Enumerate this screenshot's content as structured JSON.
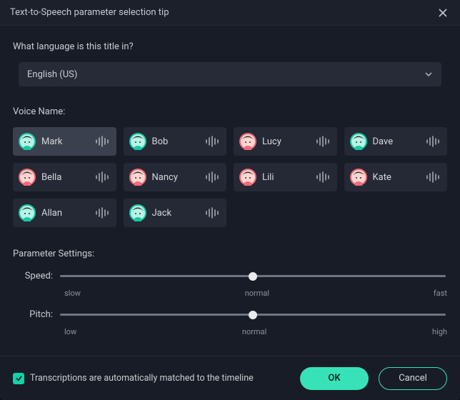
{
  "dialog": {
    "title": "Text-to-Speech parameter selection tip"
  },
  "language": {
    "label": "What language is this title in?",
    "selected": "English (US)"
  },
  "voice": {
    "label": "Voice Name:",
    "selected_index": 0,
    "items": [
      {
        "name": "Mark",
        "avatar_color": "teal"
      },
      {
        "name": "Bob",
        "avatar_color": "teal"
      },
      {
        "name": "Lucy",
        "avatar_color": "pink"
      },
      {
        "name": "Dave",
        "avatar_color": "teal"
      },
      {
        "name": "Bella",
        "avatar_color": "pink"
      },
      {
        "name": "Nancy",
        "avatar_color": "pink"
      },
      {
        "name": "Lili",
        "avatar_color": "pink"
      },
      {
        "name": "Kate",
        "avatar_color": "pink"
      },
      {
        "name": "Allan",
        "avatar_color": "teal"
      },
      {
        "name": "Jack",
        "avatar_color": "teal"
      }
    ]
  },
  "params": {
    "label": "Parameter Settings:",
    "speed": {
      "label": "Speed:",
      "value_percent": 50,
      "ticks": {
        "min": "slow",
        "mid": "normal",
        "max": "fast"
      }
    },
    "pitch": {
      "label": "Pitch:",
      "value_percent": 50,
      "ticks": {
        "min": "low",
        "mid": "normal",
        "max": "high"
      }
    }
  },
  "footer": {
    "checkbox_checked": true,
    "checkbox_label": "Transcriptions are automatically matched to the timeline",
    "ok": "OK",
    "cancel": "Cancel"
  },
  "colors": {
    "accent": "#37e2b8",
    "avatar_teal_ring": "#19c7a5",
    "avatar_teal_face": "#b7f3e6",
    "avatar_pink_ring": "#f06a78",
    "avatar_pink_face": "#ffd7d2"
  }
}
